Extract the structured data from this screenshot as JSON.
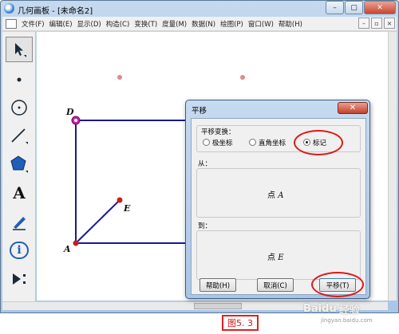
{
  "window": {
    "title": "几何画板 - [未命名2]",
    "controls": {
      "minimize": "–",
      "maximize": "▢",
      "close": "✕"
    }
  },
  "menubar": {
    "items": [
      "文件(F)",
      "编辑(E)",
      "显示(D)",
      "构造(C)",
      "变换(T)",
      "度量(M)",
      "数据(N)",
      "绘图(P)",
      "窗口(W)",
      "帮助(H)"
    ],
    "mdi": {
      "minimize": "–",
      "restore": "▫",
      "close": "×"
    }
  },
  "toolbox": {
    "tools": [
      "arrow-select-tool",
      "point-tool",
      "compass-tool",
      "straightedge-tool",
      "polygon-tool",
      "text-tool",
      "marker-tool",
      "information-tool",
      "custom-tool"
    ],
    "text_tool_glyph": "A",
    "info_tool_glyph": "i"
  },
  "canvas": {
    "points": {
      "D": "D",
      "E": "E",
      "A": "A"
    },
    "colors": {
      "segment": "#1a1a8c",
      "point": "#c81e1e",
      "selected_point": "#d01fb0",
      "faint_point": "#e08a8a"
    }
  },
  "dialog": {
    "title": "平移",
    "close_label": "✕",
    "transform_label": "平移变换：",
    "options": [
      {
        "label": "极坐标",
        "selected": false
      },
      {
        "label": "直角坐标",
        "selected": false
      },
      {
        "label": "标记",
        "selected": true
      }
    ],
    "from_label": "从：",
    "from_value_prefix": "点 ",
    "from_point": "A",
    "to_label": "到：",
    "to_value_prefix": "点 ",
    "to_point": "E",
    "buttons": {
      "help": "帮助(H)",
      "cancel": "取消(C)",
      "translate": "平移(T)"
    },
    "highlight_color": "#e01818"
  },
  "caption": "图5. 3",
  "watermark": {
    "logo": "Bai",
    "paw": "du",
    "tail": "经验",
    "url": "jingyan.baidu.com"
  }
}
